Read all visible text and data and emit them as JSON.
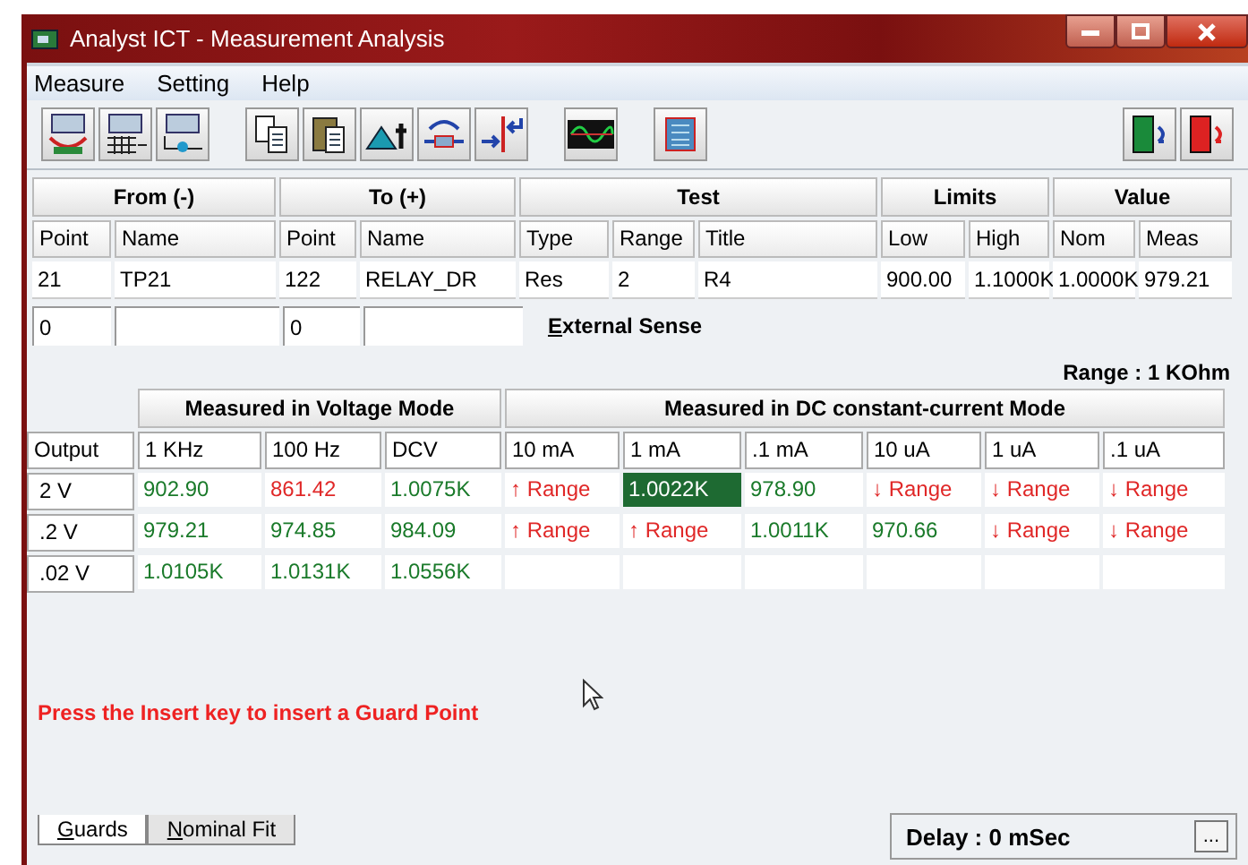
{
  "window": {
    "title": "Analyst ICT - Measurement Analysis"
  },
  "menu": [
    "Measure",
    "Setting",
    "Help"
  ],
  "test_table": {
    "groups": [
      {
        "label": "From (-)",
        "columns": [
          "Point",
          "Name"
        ]
      },
      {
        "label": "To (+)",
        "columns": [
          "Point",
          "Name"
        ]
      },
      {
        "label": "Test",
        "columns": [
          "Type",
          "Range",
          "Title"
        ]
      },
      {
        "label": "Limits",
        "columns": [
          "Low",
          "High"
        ]
      },
      {
        "label": "Value",
        "columns": [
          "Nom",
          "Meas"
        ]
      }
    ],
    "row": [
      "21",
      "TP21",
      "122",
      "RELAY_DR",
      "Res",
      "2",
      "R4",
      "900.00",
      "1.1000K",
      "1.0000K",
      "979.21"
    ]
  },
  "sense_row": {
    "from_point": "0",
    "to_point": "0",
    "label": "External Sense"
  },
  "range": "Range : 1 KOhm",
  "measure_table": {
    "row_header_column": "Output",
    "groups": [
      {
        "label": "Measured in Voltage Mode",
        "columns": [
          "1 KHz",
          "100 Hz",
          "DCV"
        ]
      },
      {
        "label": "Measured in DC constant-current Mode",
        "columns": [
          "10 mA",
          "1 mA",
          ".1 mA",
          "10 uA",
          "1 uA",
          ".1 uA"
        ]
      }
    ],
    "rows": [
      {
        "output": "2 V",
        "cells": [
          {
            "text": "902.90",
            "kind": "pass",
            "selected": false
          },
          {
            "text": "861.42",
            "kind": "fail",
            "selected": false
          },
          {
            "text": "1.0075K",
            "kind": "pass",
            "selected": false
          },
          {
            "text": "↑ Range",
            "kind": "fail",
            "selected": false
          },
          {
            "text": "1.0022K",
            "kind": "pass",
            "selected": true
          },
          {
            "text": "978.90",
            "kind": "pass",
            "selected": false
          },
          {
            "text": "↓ Range",
            "kind": "fail",
            "selected": false
          },
          {
            "text": "↓ Range",
            "kind": "fail",
            "selected": false
          },
          {
            "text": "↓ Range",
            "kind": "fail",
            "selected": false
          }
        ]
      },
      {
        "output": ".2 V",
        "cells": [
          {
            "text": "979.21",
            "kind": "pass",
            "selected": false
          },
          {
            "text": "974.85",
            "kind": "pass",
            "selected": false
          },
          {
            "text": "984.09",
            "kind": "pass",
            "selected": false
          },
          {
            "text": "↑ Range",
            "kind": "fail",
            "selected": false
          },
          {
            "text": "↑ Range",
            "kind": "fail",
            "selected": false
          },
          {
            "text": "1.0011K",
            "kind": "pass",
            "selected": false
          },
          {
            "text": "970.66",
            "kind": "pass",
            "selected": false
          },
          {
            "text": "↓ Range",
            "kind": "fail",
            "selected": false
          },
          {
            "text": "↓ Range",
            "kind": "fail",
            "selected": false
          }
        ]
      },
      {
        "output": ".02 V",
        "cells": [
          {
            "text": "1.0105K",
            "kind": "pass",
            "selected": false
          },
          {
            "text": "1.0131K",
            "kind": "pass",
            "selected": false
          },
          {
            "text": "1.0556K",
            "kind": "pass",
            "selected": false
          }
        ]
      }
    ]
  },
  "message": "Press the Insert key to insert a Guard Point",
  "tabs": [
    {
      "label": "Guards",
      "selected": true
    },
    {
      "label": "Nominal Fit",
      "selected": false
    }
  ],
  "delay": {
    "label": "Delay : 0 mSec",
    "button": "..."
  }
}
